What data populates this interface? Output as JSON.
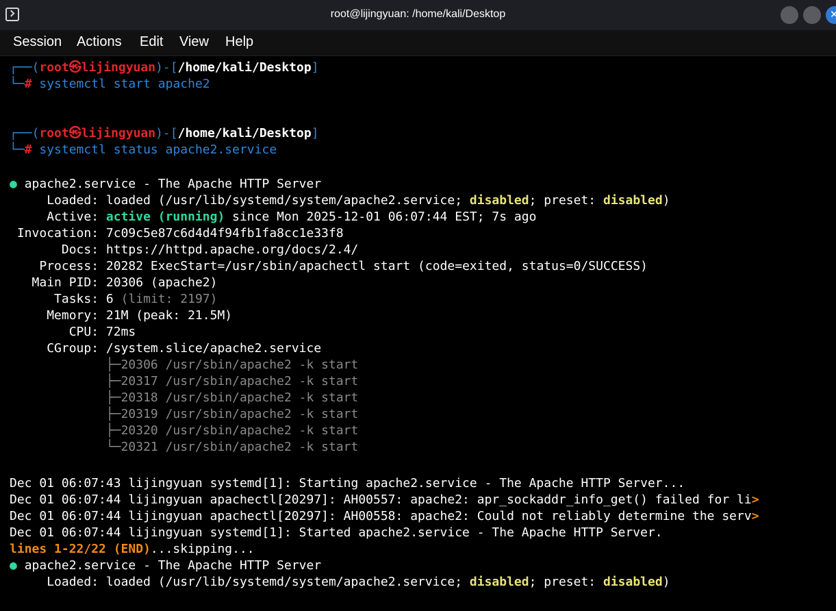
{
  "window": {
    "title": "root@lijingyuan: /home/kali/Desktop",
    "icon": "terminal-icon",
    "controls": [
      "minimize-button",
      "maximize-button",
      "close-button"
    ],
    "accent": "#2f7bd8"
  },
  "menu": [
    "Session",
    "Actions",
    "Edit",
    "View",
    "Help"
  ],
  "prompt": {
    "user": "root",
    "at_symbol": "㉿",
    "host": "lijingyuan",
    "path": "/home/kali/Desktop",
    "symbol": "#"
  },
  "commands": [
    "systemctl start apache2",
    "systemctl status apache2.service"
  ],
  "status": {
    "bullet": "●",
    "service_line": "apache2.service - The Apache HTTP Server",
    "loaded_label": "Loaded:",
    "loaded_value_1": "loaded (/usr/lib/systemd/system/apache2.service; ",
    "loaded_disabled": "disabled",
    "loaded_value_2": "; preset: ",
    "loaded_preset": "disabled",
    "loaded_value_3": ")",
    "active_label": "Active:",
    "active_state": "active (running)",
    "active_rest": "since Mon 2025-12-01 06:07:44 EST; 7s ago",
    "invocation_label": "Invocation:",
    "invocation_value": "7c09c5e87c6d4d4f94fb1fa8cc1e33f8",
    "docs_label": "Docs:",
    "docs_value": "https://httpd.apache.org/docs/2.4/",
    "process_label": "Process:",
    "process_value": "20282 ExecStart=/usr/sbin/apachectl start (code=exited, status=0/SUCCESS)",
    "mainpid_label": "Main PID:",
    "mainpid_value": "20306 (apache2)",
    "tasks_label": "Tasks:",
    "tasks_value": "6",
    "tasks_limit": "(limit: 2197)",
    "memory_label": "Memory:",
    "memory_value": "21M (peak: 21.5M)",
    "cpu_label": "CPU:",
    "cpu_value": "72ms",
    "cgroup_label": "CGroup:",
    "cgroup_value": "/system.slice/apache2.service",
    "cgroup_tree": [
      "├─20306 /usr/sbin/apache2 -k start",
      "├─20317 /usr/sbin/apache2 -k start",
      "├─20318 /usr/sbin/apache2 -k start",
      "├─20319 /usr/sbin/apache2 -k start",
      "├─20320 /usr/sbin/apache2 -k start",
      "└─20321 /usr/sbin/apache2 -k start"
    ]
  },
  "log": [
    {
      "text": "Dec 01 06:07:43 lijingyuan systemd[1]: Starting apache2.service - The Apache HTTP Server...",
      "trunc": ""
    },
    {
      "text": "Dec 01 06:07:44 lijingyuan apachectl[20297]: AH00557: apache2: apr_sockaddr_info_get() failed for li",
      "trunc": ">"
    },
    {
      "text": "Dec 01 06:07:44 lijingyuan apachectl[20297]: AH00558: apache2: Could not reliably determine the serv",
      "trunc": ">"
    },
    {
      "text": "Dec 01 06:07:44 lijingyuan systemd[1]: Started apache2.service - The Apache HTTP Server.",
      "trunc": ""
    }
  ],
  "pager": {
    "status": "lines 1-22/22 (END)",
    "skipping": "...skipping..."
  },
  "repeat": {
    "service_line": "apache2.service - The Apache HTTP Server"
  }
}
